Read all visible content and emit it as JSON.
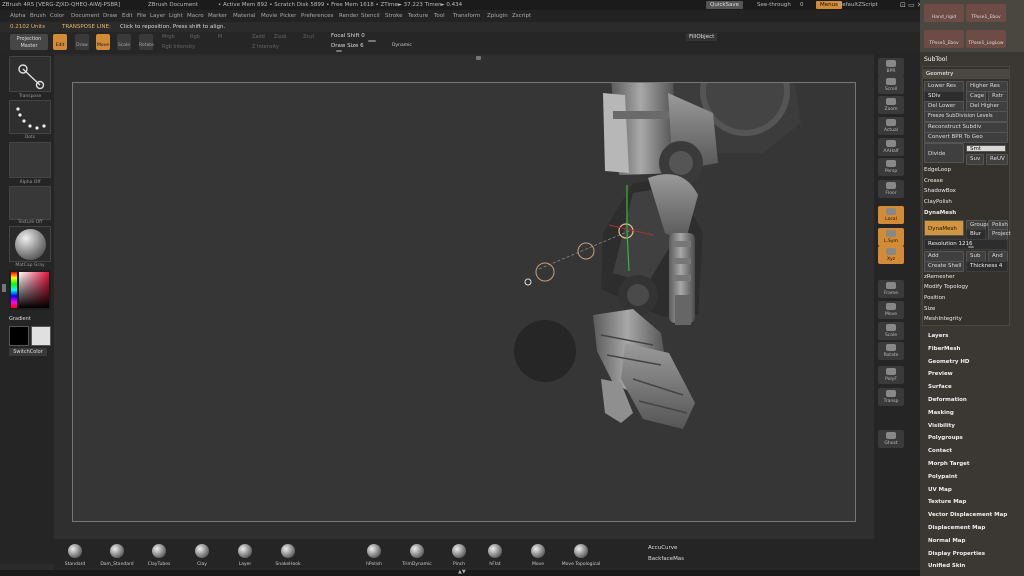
{
  "titlebar": {
    "app": "ZBrush 4R5",
    "serial": "[VERG-ZJXD-QHEQ-AIWJ-PSBR]",
    "document": "ZBrush Document",
    "mem": "• Active Mem 892 • Scratch Disk 5899 • Free Mem 1618 • ZTime► 37.223 Timer► 0.434",
    "quicksave": "QuickSave",
    "seethrough": "See-through",
    "seethrough_value": "0",
    "menus": "Menus",
    "defaultscript": "DefaultZScript"
  },
  "menubar": [
    "Alpha",
    "Brush",
    "Color",
    "Document",
    "Draw",
    "Edit",
    "File",
    "Layer",
    "Light",
    "Macro",
    "Marker",
    "Material",
    "Movie",
    "Picker",
    "Preferences",
    "Render",
    "Stencil",
    "Stroke",
    "Texture",
    "Tool",
    "Transform",
    "Zplugin",
    "Zscript"
  ],
  "info": {
    "units": "0.2102 Units",
    "mode": "TRANSPOSE LINE:",
    "hint": "Click to reposition. Press shift to align."
  },
  "toolrow": {
    "projection_master_line1": "Projection",
    "projection_master_line2": "Master",
    "edit": "Edit",
    "draw": "Draw",
    "move": "Move",
    "scale": "Scale",
    "rotate": "Rotate",
    "mrgb": "Mrgb",
    "rgb": "Rgb",
    "m": "M",
    "zadd": "Zadd",
    "zsub": "Zsub",
    "zcut": "Zcut",
    "rgb_intensity": "Rgb Intensity",
    "z_intensity": "Z Intensity",
    "focal_shift": "Focal Shift 0",
    "draw_size": "Draw Size 6",
    "dynamic": "Dynamic",
    "fill_object": "FillObject"
  },
  "leftshelf": {
    "transpose": "Transpose",
    "dots": "Dots",
    "alpha_off": "Alpha Off",
    "texture_off": "Texture Off",
    "material": "MatCap Gray",
    "gradient": "Gradient",
    "switch_color": "SwitchColor"
  },
  "rightshelf": [
    {
      "name": "bpr",
      "label": "BPR",
      "on": false
    },
    {
      "name": "scroll",
      "label": "Scroll",
      "on": false
    },
    {
      "name": "zoom",
      "label": "Zoom",
      "on": false
    },
    {
      "name": "actual",
      "label": "Actual",
      "on": false
    },
    {
      "name": "aahalf",
      "label": "AAHalf",
      "on": false
    },
    {
      "name": "persp",
      "label": "Persp",
      "on": false
    },
    {
      "name": "floor",
      "label": "Floor",
      "on": false
    },
    {
      "name": "local",
      "label": "Local",
      "on": true
    },
    {
      "name": "lsym",
      "label": "L.Sym",
      "on": true
    },
    {
      "name": "xyz",
      "label": "Xyz",
      "on": true
    },
    {
      "name": "frame",
      "label": "Frame",
      "on": false
    },
    {
      "name": "move",
      "label": "Move",
      "on": false
    },
    {
      "name": "scale",
      "label": "Scale",
      "on": false
    },
    {
      "name": "rotate",
      "label": "Rotate",
      "on": false
    },
    {
      "name": "polyf",
      "label": "PolyF",
      "on": false
    },
    {
      "name": "transp",
      "label": "Transp",
      "on": false
    },
    {
      "name": "ghost",
      "label": "Ghost",
      "on": false
    }
  ],
  "rpanel": {
    "tiles": [
      "Hand_rigid",
      "TPose1_Ebov",
      "TPose1_Ebov",
      "TPose1_LegLow"
    ],
    "subtool": "SubTool",
    "geometry": "Geometry",
    "lower_res": "Lower Res",
    "higher_res": "Higher Res",
    "sdiv": "SDiv",
    "cage": "Cage",
    "rstr": "Rstr",
    "del_lower": "Del Lower",
    "del_higher": "Del Higher",
    "freeze_subdiv": "Freeze SubDivision Levels",
    "reconstruct": "Reconstruct Subdiv",
    "convert_bpr": "Convert BPR To Geo",
    "divide": "Divide",
    "smt": "Smt",
    "suv": "Suv",
    "reuv": "ReUV",
    "edgeloop": "EdgeLoop",
    "crease": "Crease",
    "shadowbox": "ShadowBox",
    "claypolish": "ClayPolish",
    "dynamesh_header": "DynaMesh",
    "dynamesh": "DynaMesh",
    "groups": "Groups",
    "polish": "Polish",
    "blur": "Blur 2",
    "project": "Project",
    "resolution": "Resolution 1216",
    "add": "Add",
    "sub": "Sub",
    "and": "And",
    "create_shell": "Create Shell",
    "thickness": "Thickness 4",
    "zremesher": "zRemesher",
    "modify_topology": "Modify Topology",
    "position": "Position",
    "size": "Size",
    "meshintegrity": "MeshIntegrity",
    "menu": [
      "Layers",
      "FiberMesh",
      "Geometry HD",
      "Preview",
      "Surface",
      "Deformation",
      "Masking",
      "Visibility",
      "Polygroups",
      "Contact",
      "Morph Target",
      "Polypaint",
      "UV Map",
      "Texture Map",
      "Vector Displacement Map",
      "Displacement Map",
      "Normal Map",
      "Display Properties",
      "Unified Skin"
    ]
  },
  "brushes": [
    "Standard",
    "Dam_Standard",
    "ClayTubes",
    "Clay",
    "Layer",
    "SnakeHook",
    "hPolish",
    "TrimDynamic",
    "Pinch",
    "hFlat",
    "Move",
    "Move Topological"
  ],
  "accucurve": "AccuCurve",
  "backfacemask": "BackfaceMas"
}
